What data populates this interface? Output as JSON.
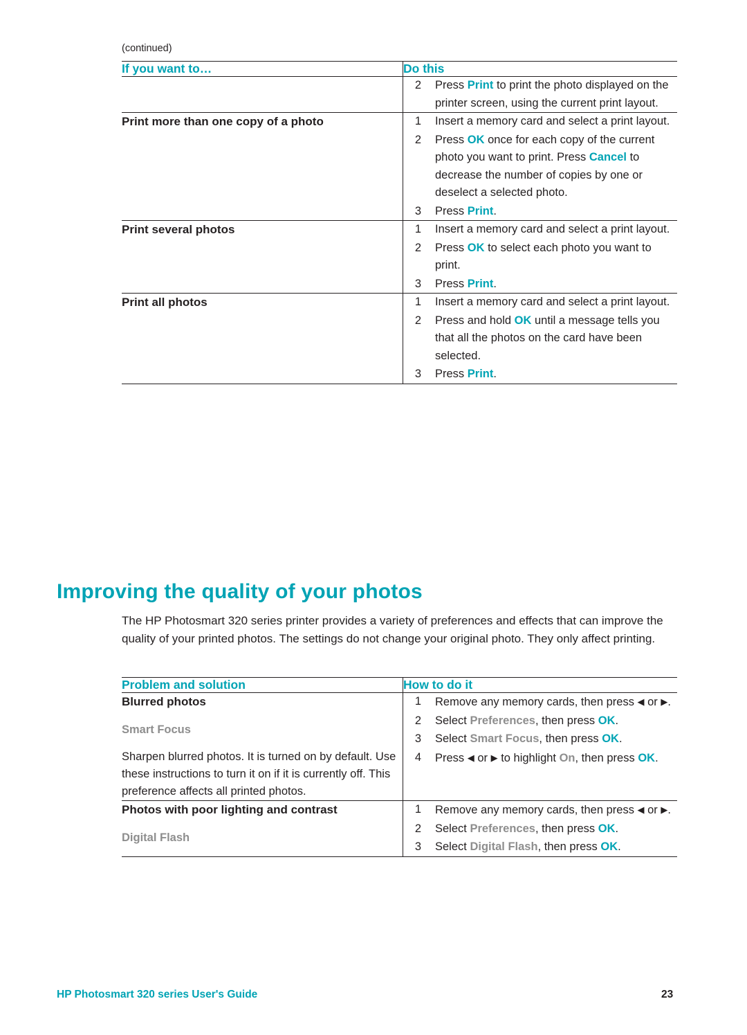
{
  "page": {
    "continued_label": "(continued)",
    "footer_left": "HP Photosmart 320 series User's Guide",
    "footer_page_number": "23"
  },
  "table1": {
    "headers": {
      "left": "If you want to…",
      "right": "Do this"
    },
    "rows": [
      {
        "label": "",
        "steps": [
          {
            "num": "2",
            "segments": [
              {
                "t": "Press ",
                "s": "plain"
              },
              {
                "t": "Print",
                "s": "teal"
              },
              {
                "t": " to print the photo displayed on the printer screen, using the current print layout.",
                "s": "plain"
              }
            ]
          }
        ]
      },
      {
        "label": "Print more than one copy of a photo",
        "steps": [
          {
            "num": "1",
            "segments": [
              {
                "t": "Insert a memory card and select a print layout.",
                "s": "plain"
              }
            ]
          },
          {
            "num": "2",
            "segments": [
              {
                "t": "Press ",
                "s": "plain"
              },
              {
                "t": "OK",
                "s": "teal"
              },
              {
                "t": " once for each copy of the current photo you want to print. Press ",
                "s": "plain"
              },
              {
                "t": "Cancel",
                "s": "teal"
              },
              {
                "t": " to decrease the number of copies by one or deselect a selected photo.",
                "s": "plain"
              }
            ]
          },
          {
            "num": "3",
            "segments": [
              {
                "t": "Press ",
                "s": "plain"
              },
              {
                "t": "Print",
                "s": "teal"
              },
              {
                "t": ".",
                "s": "plain"
              }
            ]
          }
        ]
      },
      {
        "label": "Print several photos",
        "steps": [
          {
            "num": "1",
            "segments": [
              {
                "t": "Insert a memory card and select a print layout.",
                "s": "plain"
              }
            ]
          },
          {
            "num": "2",
            "segments": [
              {
                "t": "Press ",
                "s": "plain"
              },
              {
                "t": "OK",
                "s": "teal"
              },
              {
                "t": " to select each photo you want to print.",
                "s": "plain"
              }
            ]
          },
          {
            "num": "3",
            "segments": [
              {
                "t": "Press ",
                "s": "plain"
              },
              {
                "t": "Print",
                "s": "teal"
              },
              {
                "t": ".",
                "s": "plain"
              }
            ]
          }
        ]
      },
      {
        "label": "Print all photos",
        "steps": [
          {
            "num": "1",
            "segments": [
              {
                "t": "Insert a memory card and select a print layout.",
                "s": "plain"
              }
            ]
          },
          {
            "num": "2",
            "segments": [
              {
                "t": "Press and hold ",
                "s": "plain"
              },
              {
                "t": "OK",
                "s": "teal"
              },
              {
                "t": " until a message tells you that all the photos on the card have been selected.",
                "s": "plain"
              }
            ]
          },
          {
            "num": "3",
            "segments": [
              {
                "t": "Press ",
                "s": "plain"
              },
              {
                "t": "Print",
                "s": "teal"
              },
              {
                "t": ".",
                "s": "plain"
              }
            ]
          }
        ]
      }
    ]
  },
  "section": {
    "heading": "Improving the quality of your photos",
    "intro": "The HP Photosmart 320 series printer provides a variety of preferences and effects that can improve the quality of your printed photos. The settings do not change your original photo. They only affect printing."
  },
  "table2": {
    "headers": {
      "left": "Problem and solution",
      "right": "How to do it"
    },
    "rows": [
      {
        "label": "Blurred photos",
        "sublabel": "Smart Focus",
        "paragraph": "Sharpen blurred photos. It is turned on by default. Use these instructions to turn it on if it is currently off. This preference affects all printed photos.",
        "steps": [
          {
            "num": "1",
            "segments": [
              {
                "t": "Remove any memory cards, then press ",
                "s": "plain"
              },
              {
                "t": "◀",
                "s": "arrow"
              },
              {
                "t": " or ",
                "s": "plain"
              },
              {
                "t": "▶",
                "s": "arrow"
              },
              {
                "t": ".",
                "s": "plain"
              }
            ]
          },
          {
            "num": "2",
            "segments": [
              {
                "t": "Select ",
                "s": "plain"
              },
              {
                "t": "Preferences",
                "s": "gray"
              },
              {
                "t": ", then press ",
                "s": "plain"
              },
              {
                "t": "OK",
                "s": "teal"
              },
              {
                "t": ".",
                "s": "plain"
              }
            ]
          },
          {
            "num": "3",
            "segments": [
              {
                "t": "Select ",
                "s": "plain"
              },
              {
                "t": "Smart Focus",
                "s": "gray"
              },
              {
                "t": ", then press ",
                "s": "plain"
              },
              {
                "t": "OK",
                "s": "teal"
              },
              {
                "t": ".",
                "s": "plain"
              }
            ]
          },
          {
            "num": "4",
            "segments": [
              {
                "t": "Press ",
                "s": "plain"
              },
              {
                "t": "◀",
                "s": "arrow"
              },
              {
                "t": " or ",
                "s": "plain"
              },
              {
                "t": "▶",
                "s": "arrow"
              },
              {
                "t": " to highlight ",
                "s": "plain"
              },
              {
                "t": "On",
                "s": "gray"
              },
              {
                "t": ", then press ",
                "s": "plain"
              },
              {
                "t": "OK",
                "s": "teal"
              },
              {
                "t": ".",
                "s": "plain"
              }
            ]
          }
        ]
      },
      {
        "label": "Photos with poor lighting and contrast",
        "sublabel": "Digital Flash",
        "paragraph": "",
        "steps": [
          {
            "num": "1",
            "segments": [
              {
                "t": "Remove any memory cards, then press ",
                "s": "plain"
              },
              {
                "t": "◀",
                "s": "arrow"
              },
              {
                "t": " or ",
                "s": "plain"
              },
              {
                "t": "▶",
                "s": "arrow"
              },
              {
                "t": ".",
                "s": "plain"
              }
            ]
          },
          {
            "num": "2",
            "segments": [
              {
                "t": "Select ",
                "s": "plain"
              },
              {
                "t": "Preferences",
                "s": "gray"
              },
              {
                "t": ", then press ",
                "s": "plain"
              },
              {
                "t": "OK",
                "s": "teal"
              },
              {
                "t": ".",
                "s": "plain"
              }
            ]
          },
          {
            "num": "3",
            "segments": [
              {
                "t": "Select ",
                "s": "plain"
              },
              {
                "t": "Digital Flash",
                "s": "gray"
              },
              {
                "t": ", then press ",
                "s": "plain"
              },
              {
                "t": "OK",
                "s": "teal"
              },
              {
                "t": ".",
                "s": "plain"
              }
            ]
          }
        ]
      }
    ]
  }
}
